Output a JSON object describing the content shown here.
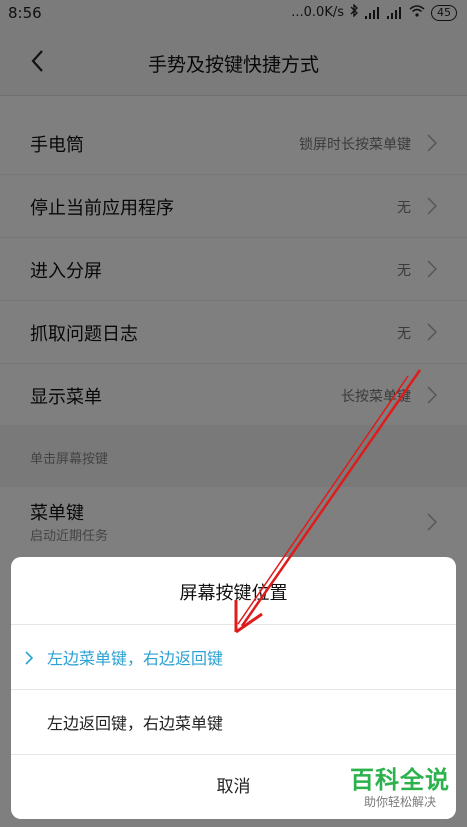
{
  "status_bar": {
    "time": "8:56",
    "network_speed": "...0.0K/s",
    "battery": "45"
  },
  "header": {
    "title": "手势及按键快捷方式"
  },
  "settings": [
    {
      "label": "手电筒",
      "value": "锁屏时长按菜单键"
    },
    {
      "label": "停止当前应用程序",
      "value": "无"
    },
    {
      "label": "进入分屏",
      "value": "无"
    },
    {
      "label": "抓取问题日志",
      "value": "无"
    },
    {
      "label": "显示菜单",
      "value": "长按菜单键"
    }
  ],
  "section": {
    "title": "单击屏幕按键"
  },
  "menu_key": {
    "label": "菜单键",
    "sub": "启动近期任务"
  },
  "dialog": {
    "title": "屏幕按键位置",
    "options": [
      {
        "label": "左边菜单键，右边返回键",
        "selected": true
      },
      {
        "label": "左边返回键，右边菜单键",
        "selected": false
      }
    ],
    "cancel": "取消"
  },
  "watermark": {
    "main": "百科全说",
    "sub": "助你轻松解决"
  },
  "colors": {
    "accent": "#2aa2d4",
    "arrow": "#e01b1b",
    "watermark": "#2bb24c"
  }
}
